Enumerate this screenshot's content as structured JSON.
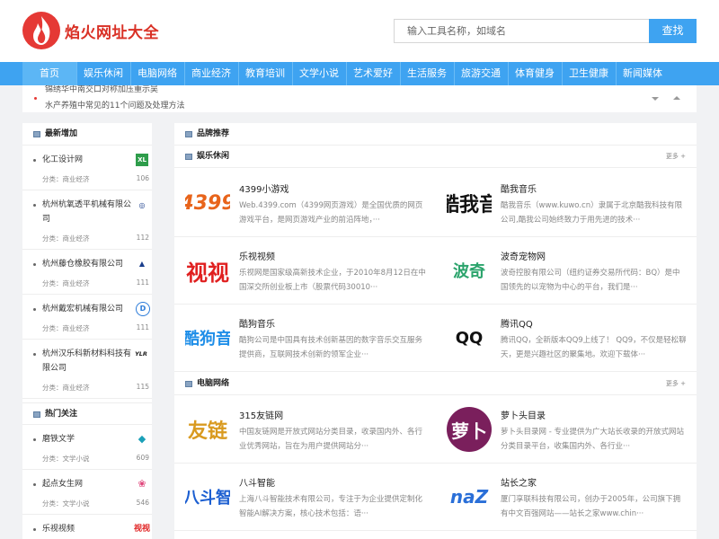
{
  "header": {
    "logo_text": "焰火网址大全",
    "search_placeholder": "输入工具名称，如域名",
    "search_button": "查找"
  },
  "nav": {
    "items": [
      "首页",
      "娱乐休闲",
      "电脑网络",
      "商业经济",
      "教育培训",
      "文学小说",
      "艺术爱好",
      "生活服务",
      "旅游交通",
      "体育健身",
      "卫生健康",
      "新闻媒体"
    ]
  },
  "ticker": {
    "line1": "锦绣华中南交口对称加压重示吴",
    "line2": "水产养殖中常见的11个问题及处理方法"
  },
  "sidebar": {
    "latest_title": "最新增加",
    "latest_items": [
      {
        "name": "化工设计网",
        "category": "分类：商业经济",
        "count": "106",
        "icon": "XL"
      },
      {
        "name": "杭州杭氧透平机械有限公司",
        "category": "分类：商业经济",
        "count": "112",
        "icon": "◎"
      },
      {
        "name": "杭州藤仓橡胶有限公司",
        "category": "分类：商业经济",
        "count": "111",
        "icon": "▲"
      },
      {
        "name": "杭州戴宏机械有限公司",
        "category": "分类：商业经济",
        "count": "111",
        "icon": "D"
      },
      {
        "name": "杭州汉乐科新材料科技有限公司",
        "category": "分类：商业经济",
        "count": "115",
        "icon": "YLR"
      }
    ],
    "hot_title": "热门关注",
    "hot_items": [
      {
        "name": "磨铁文学",
        "category": "分类：文学小说",
        "count": "609",
        "icon": "◆"
      },
      {
        "name": "起点女生网",
        "category": "分类：文学小说",
        "count": "546",
        "icon": "❀"
      },
      {
        "name": "乐视视频",
        "category": "",
        "count": "",
        "icon": "视视"
      }
    ]
  },
  "main": {
    "brand_title": "品牌推荐",
    "sections": [
      {
        "title": "娱乐休闲",
        "more": "更多 +",
        "cards": [
          {
            "title": "4399小游戏",
            "desc": "Web.4399.com（4399网页游戏）是全国优质的网页游戏平台，是网页游戏产业的前沿阵地，···",
            "logo": "4399",
            "logo_color": "#e8641b"
          },
          {
            "title": "酷我音乐",
            "desc": "酷我音乐（www.kuwo.cn）隶属于北京酷我科技有限公司,酷我公司始终致力于用先进的技术···",
            "logo": "酷我音",
            "logo_color": "#111111"
          },
          {
            "title": "乐视视频",
            "desc": "乐视网是国家级高新技术企业，于2010年8月12日在中国深交所创业板上市（股票代码30010···",
            "logo": "视视",
            "logo_color": "#e02020"
          },
          {
            "title": "波奇宠物网",
            "desc": "波奇控股有限公司（纽约证券交易所代码：BQ）是中国领先的以宠物为中心的平台，我们是···",
            "logo": "波奇",
            "logo_color": "#2aa36b"
          },
          {
            "title": "酷狗音乐",
            "desc": "酷狗公司是中国具有技术创新基因的数字音乐交互服务提供商，互联网技术创新的领军企业···",
            "logo": "酷狗音",
            "logo_color": "#1f8ee8"
          },
          {
            "title": "腾讯QQ",
            "desc": "腾讯QQ，全新版本QQ9上线了！ QQ9，不仅是轻松聊天，更是兴趣社区的聚集地。欢迎下载体···",
            "logo": "QQ",
            "logo_color": "#111111"
          }
        ]
      },
      {
        "title": "电脑网络",
        "more": "更多 +",
        "cards": [
          {
            "title": "315友链网",
            "desc": "中国友链网是开放式网站分类目录，收录国内外、各行业优秀网站，旨在为用户提供网站分···",
            "logo": "友链",
            "logo_color": "#d99a1f"
          },
          {
            "title": "萝卜头目录",
            "desc": "萝卜头目录网 - 专业提供为广大站长收录的开放式网站分类目录平台，收集国内外、各行业···",
            "logo": "萝卜",
            "logo_color": "#7a1f5c"
          },
          {
            "title": "八斗智能",
            "desc": "上海八斗智能技术有限公司，专注于为企业提供定制化智能AI解决方案，核心技术包括：语···",
            "logo": "八斗智",
            "logo_color": "#1c5fd1"
          },
          {
            "title": "站长之家",
            "desc": "厦门享联科技有限公司，创办于2005年，公司旗下拥有中文百强网站——站长之家www.chin···",
            "logo": "naZ",
            "logo_color": "#2a6fd8"
          }
        ]
      }
    ]
  }
}
